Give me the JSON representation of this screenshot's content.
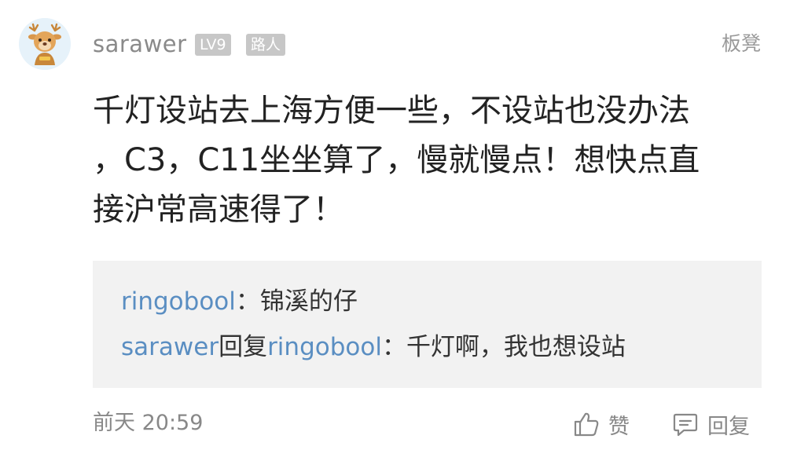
{
  "comment": {
    "username": "sarawer",
    "level_badge": "LV9",
    "title_badge": "路人",
    "floor_label": "板凳",
    "content_lines": [
      "千灯设站去上海方便一些，不设站也没办法",
      "，C3，C11坐坐算了，慢就慢点！想快点直",
      "接沪常高速得了！"
    ],
    "replies": [
      {
        "user": "ringobool",
        "separator": "：",
        "text": "锦溪的仔"
      },
      {
        "user": "sarawer",
        "verb": "回复",
        "target": "ringobool",
        "separator": "：",
        "text": "千灯啊，我也想设站"
      }
    ],
    "time": "前天 20:59",
    "like_label": "赞",
    "reply_label": "回复"
  },
  "colors": {
    "username_link": "#5a8ec2",
    "badge_bg": "#c7c7c7",
    "reply_bg": "#f2f2f2"
  }
}
